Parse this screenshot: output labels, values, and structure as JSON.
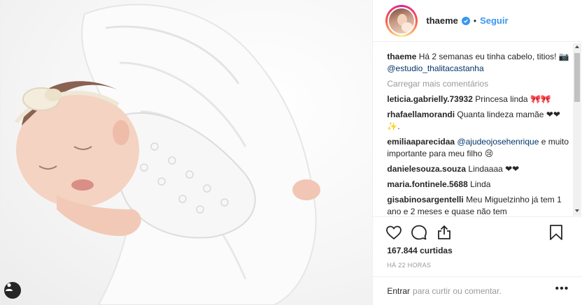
{
  "post": {
    "username": "thaeme",
    "follow_label": "Seguir",
    "separator": "•",
    "caption": {
      "user": "thaeme",
      "text": "Há 2 semanas eu tinha cabelo, titios! 📷",
      "mention": "@estudio_thalitacastanha"
    },
    "load_more_label": "Carregar mais comentários",
    "comments": [
      {
        "user": "leticia.gabrielly.73932",
        "text": "Princesa linda 🎀🎀"
      },
      {
        "user": "rhafaellamorandi",
        "text": "Quanta lindeza mamãe ❤❤✨."
      },
      {
        "user": "emiliaaparecidaa",
        "mention": "@ajudeojosehenrique",
        "text": " e muito importante para meu filho 😢"
      },
      {
        "user": "danielesouza.souza",
        "text": "Lindaaaa ❤❤"
      },
      {
        "user": "maria.fontinele.5688",
        "text": "Linda"
      },
      {
        "user": "gisabinosargentelli",
        "text": "Meu Miguelzinho já tem 1 ano e 2 meses e quase não tem"
      }
    ],
    "likes_label": "167.844 curtidas",
    "time_label": "HÁ 22 HORAS",
    "login_label": "Entrar",
    "login_suffix": "para curtir ou comentar.",
    "more_label": "•••"
  },
  "colors": {
    "link": "#3897f0",
    "mention": "#003569",
    "muted": "#999999",
    "text": "#262626"
  },
  "icons": {
    "like": "heart-icon",
    "comment": "comment-bubble-icon",
    "share": "share-icon",
    "save": "bookmark-icon",
    "verified": "verified-badge-icon",
    "tag": "user-tag-icon"
  }
}
